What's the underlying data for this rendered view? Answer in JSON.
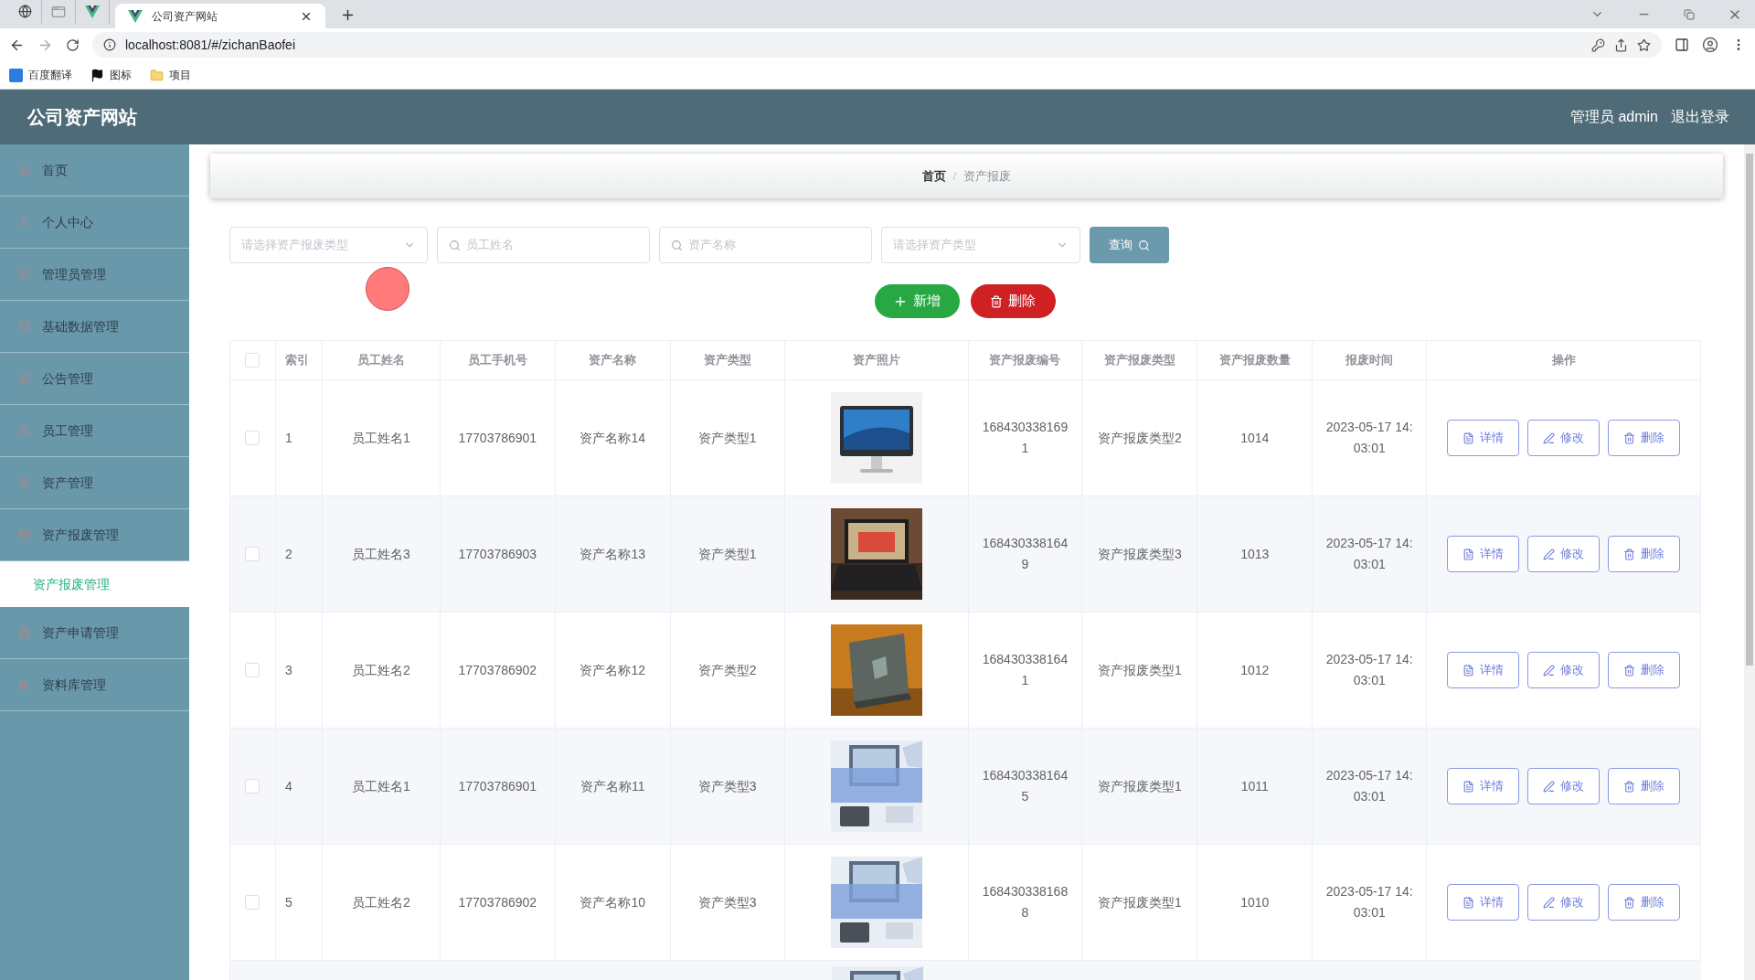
{
  "browser": {
    "tabs": [
      {
        "kind": "globe",
        "selected": false
      },
      {
        "kind": "page",
        "selected": false
      },
      {
        "kind": "vue",
        "selected": false
      },
      {
        "kind": "vue",
        "title": "公司资产网站",
        "selected": true
      }
    ],
    "url": "localhost:8081/#/zichanBaofei",
    "bookmarks": [
      {
        "kind": "translate",
        "label": "百度翻译"
      },
      {
        "kind": "flag",
        "label": "图标"
      },
      {
        "kind": "folder",
        "label": "项目"
      }
    ]
  },
  "app": {
    "title": "公司资产网站",
    "user": "管理员 admin",
    "logout": "退出登录"
  },
  "sidebar": {
    "items": [
      {
        "kind": "home",
        "label": "首页",
        "selected": false
      },
      {
        "kind": "user",
        "label": "个人中心",
        "selected": false
      },
      {
        "kind": "admin",
        "label": "管理员管理",
        "selected": false
      },
      {
        "kind": "data",
        "label": "基础数据管理",
        "selected": false
      },
      {
        "kind": "notice",
        "label": "公告管理",
        "selected": false
      },
      {
        "kind": "staff",
        "label": "员工管理",
        "selected": false
      },
      {
        "kind": "asset",
        "label": "资产管理",
        "selected": false
      },
      {
        "kind": "scrap",
        "label": "资产报废管理",
        "selected": false,
        "expanded": true,
        "children": [
          {
            "label": "资产报废管理",
            "selected": true
          }
        ]
      },
      {
        "kind": "apply",
        "label": "资产申请管理",
        "selected": false
      },
      {
        "kind": "library",
        "label": "资料库管理",
        "selected": false
      }
    ]
  },
  "breadcrumb": {
    "items": [
      "首页",
      "资产报废"
    ],
    "separator": "/"
  },
  "filters": [
    {
      "kind": "select",
      "placeholder": "请选择资产报废类型"
    },
    {
      "kind": "search",
      "placeholder": "员工姓名"
    },
    {
      "kind": "search",
      "placeholder": "资产名称"
    },
    {
      "kind": "select",
      "placeholder": "请选择资产类型"
    }
  ],
  "query_button": "查询",
  "actions": [
    {
      "kind": "add",
      "label": "新增"
    },
    {
      "kind": "delete",
      "label": "删除"
    }
  ],
  "table": {
    "select_all": {
      "checked": false
    },
    "columns": [
      "索引",
      "员工姓名",
      "员工手机号",
      "资产名称",
      "资产类型",
      "资产照片",
      "资产报废编号",
      "资产报废类型",
      "资产报废数量",
      "报废时间",
      "操作"
    ],
    "rows": [
      {
        "checked": false,
        "index": "1",
        "employee": "员工姓名1",
        "phone": "17703786901",
        "asset": "资产名称14",
        "asset_type": "资产类型1",
        "code": "1684303381691",
        "scrap_type": "资产报废类型2",
        "quantity": "1014",
        "time": "2023-05-17 14:03:01",
        "buttons": [
          {
            "kind": "detail",
            "label": "详情"
          },
          {
            "kind": "edit",
            "label": "修改"
          },
          {
            "kind": "delete",
            "label": "删除"
          }
        ]
      },
      {
        "checked": false,
        "index": "2",
        "employee": "员工姓名3",
        "phone": "17703786903",
        "asset": "资产名称13",
        "asset_type": "资产类型1",
        "code": "1684303381649",
        "scrap_type": "资产报废类型3",
        "quantity": "1013",
        "time": "2023-05-17 14:03:01",
        "buttons": [
          {
            "kind": "detail",
            "label": "详情"
          },
          {
            "kind": "edit",
            "label": "修改"
          },
          {
            "kind": "delete",
            "label": "删除"
          }
        ]
      },
      {
        "checked": false,
        "index": "3",
        "employee": "员工姓名2",
        "phone": "17703786902",
        "asset": "资产名称12",
        "asset_type": "资产类型2",
        "code": "1684303381641",
        "scrap_type": "资产报废类型1",
        "quantity": "1012",
        "time": "2023-05-17 14:03:01",
        "buttons": [
          {
            "kind": "detail",
            "label": "详情"
          },
          {
            "kind": "edit",
            "label": "修改"
          },
          {
            "kind": "delete",
            "label": "删除"
          }
        ]
      },
      {
        "checked": false,
        "index": "4",
        "employee": "员工姓名1",
        "phone": "17703786901",
        "asset": "资产名称11",
        "asset_type": "资产类型3",
        "code": "1684303381645",
        "scrap_type": "资产报废类型1",
        "quantity": "1011",
        "time": "2023-05-17 14:03:01",
        "buttons": [
          {
            "kind": "detail",
            "label": "详情"
          },
          {
            "kind": "edit",
            "label": "修改"
          },
          {
            "kind": "delete",
            "label": "删除"
          }
        ]
      },
      {
        "checked": false,
        "index": "5",
        "employee": "员工姓名2",
        "phone": "17703786902",
        "asset": "资产名称10",
        "asset_type": "资产类型3",
        "code": "1684303381688",
        "scrap_type": "资产报废类型1",
        "quantity": "1010",
        "time": "2023-05-17 14:03:01",
        "buttons": [
          {
            "kind": "detail",
            "label": "详情"
          },
          {
            "kind": "edit",
            "label": "修改"
          },
          {
            "kind": "delete",
            "label": "删除"
          }
        ]
      }
    ]
  }
}
